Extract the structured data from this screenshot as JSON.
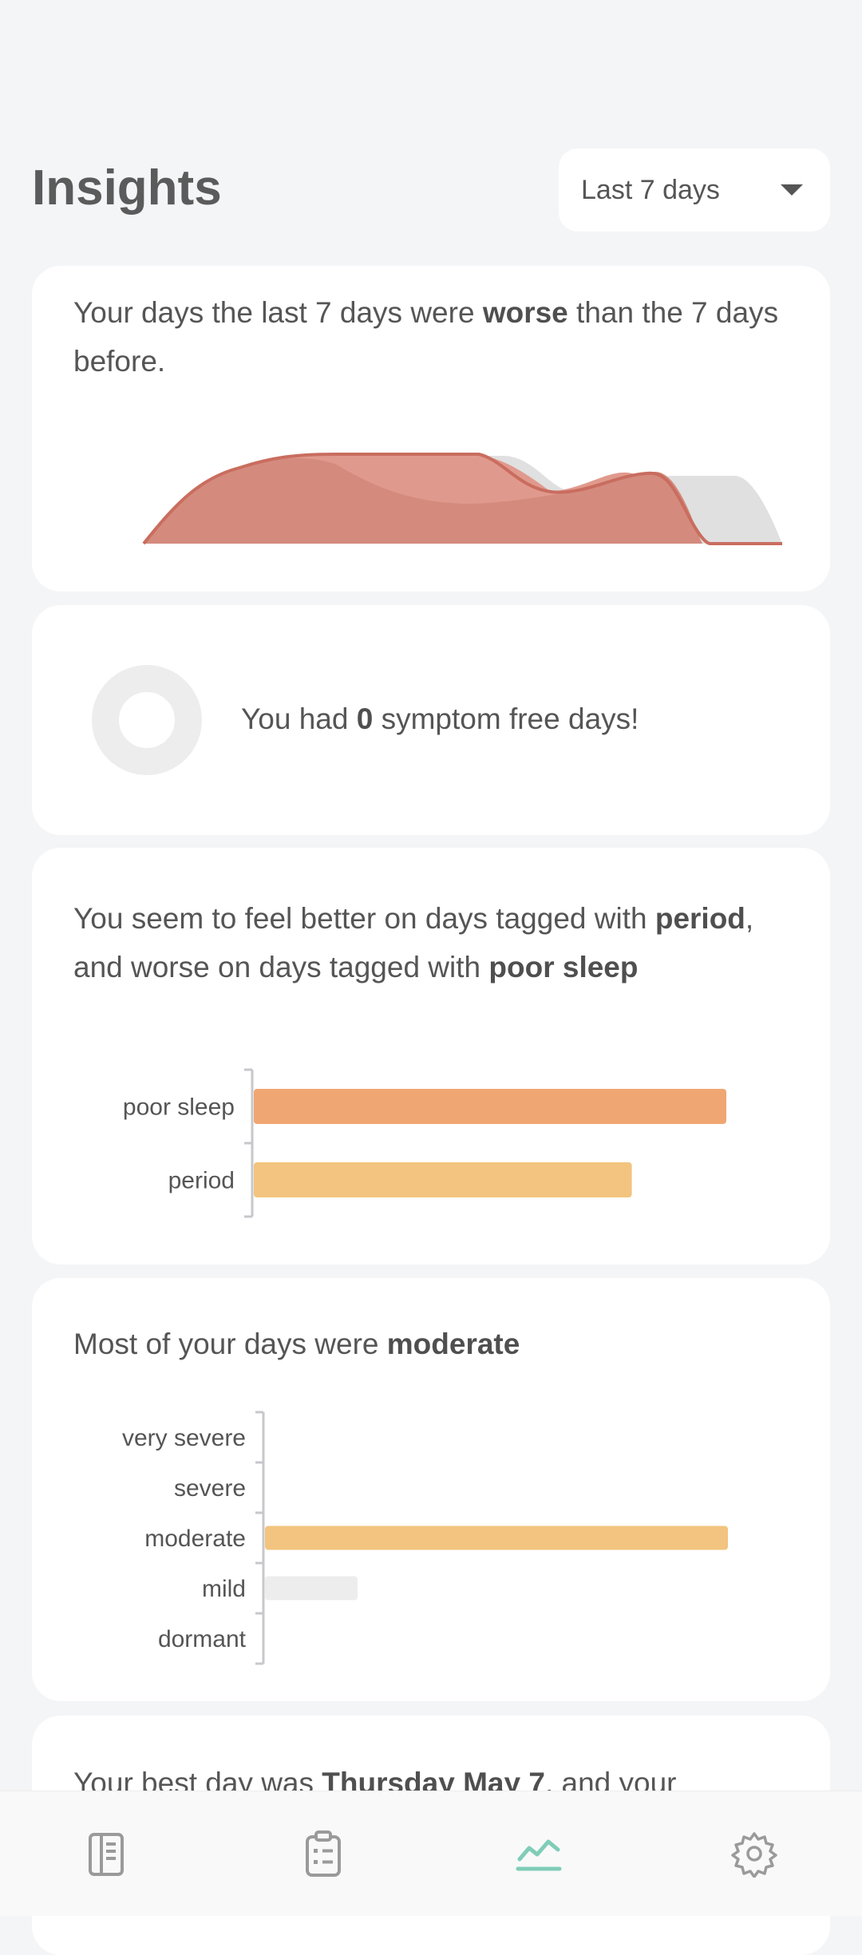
{
  "header": {
    "title": "Insights",
    "range_selected": "Last 7 days"
  },
  "trend_card": {
    "text_prefix": "Your days the last 7 days were ",
    "text_emphasis": "worse",
    "text_suffix": " than the 7 days before."
  },
  "symptom_free_card": {
    "text_prefix": "You had ",
    "count": "0",
    "text_suffix": " symptom free days!",
    "symptom_free_fraction": 0
  },
  "tags_card": {
    "text_1": "You seem to feel better on days tagged with ",
    "better_tag": "period",
    "text_2": ", and worse on days tagged with ",
    "worse_tag": "poor sleep"
  },
  "severity_card": {
    "text_prefix": "Most of your days were ",
    "text_emphasis": "moderate"
  },
  "best_day_card": {
    "text_prefix": "Your best day was ",
    "text_emphasis": "Thursday May 7",
    "text_suffix": ", and your"
  },
  "chart_data": [
    {
      "type": "area",
      "series": [
        {
          "values": [
            0,
            0.65,
            0.95,
            0.95,
            0.7,
            0.72,
            0.55,
            0
          ]
        },
        {
          "values": [
            0,
            0.6,
            1,
            0.95,
            0.65,
            0.5,
            0.65,
            0.85,
            0.9,
            0
          ]
        }
      ],
      "colors": [
        "#e0e0e0",
        "#d48b7e",
        "#e09a8d",
        "#c96d5f"
      ]
    },
    {
      "type": "bar",
      "orientation": "horizontal",
      "categories": [
        "poor sleep",
        "period"
      ],
      "values": [
        1.0,
        0.8
      ],
      "xlim": [
        0,
        1
      ],
      "colors": [
        "#f0a672",
        "#f2c47f"
      ]
    },
    {
      "type": "bar",
      "orientation": "horizontal",
      "categories": [
        "very severe",
        "severe",
        "moderate",
        "mild",
        "dormant"
      ],
      "values": [
        0,
        0,
        1.0,
        0.2,
        0
      ],
      "xlim": [
        0,
        1
      ],
      "colors": [
        "#f2c47f",
        "#f2c47f",
        "#f2c47f",
        "#ededed",
        "#ededed"
      ]
    }
  ],
  "nav": {
    "items": [
      {
        "icon": "journal-icon"
      },
      {
        "icon": "checklist-icon"
      },
      {
        "icon": "trend-chart-icon",
        "active": true
      },
      {
        "icon": "gear-icon"
      }
    ],
    "active_color": "#7fcdb8",
    "inactive_color": "#9a9a9a"
  }
}
